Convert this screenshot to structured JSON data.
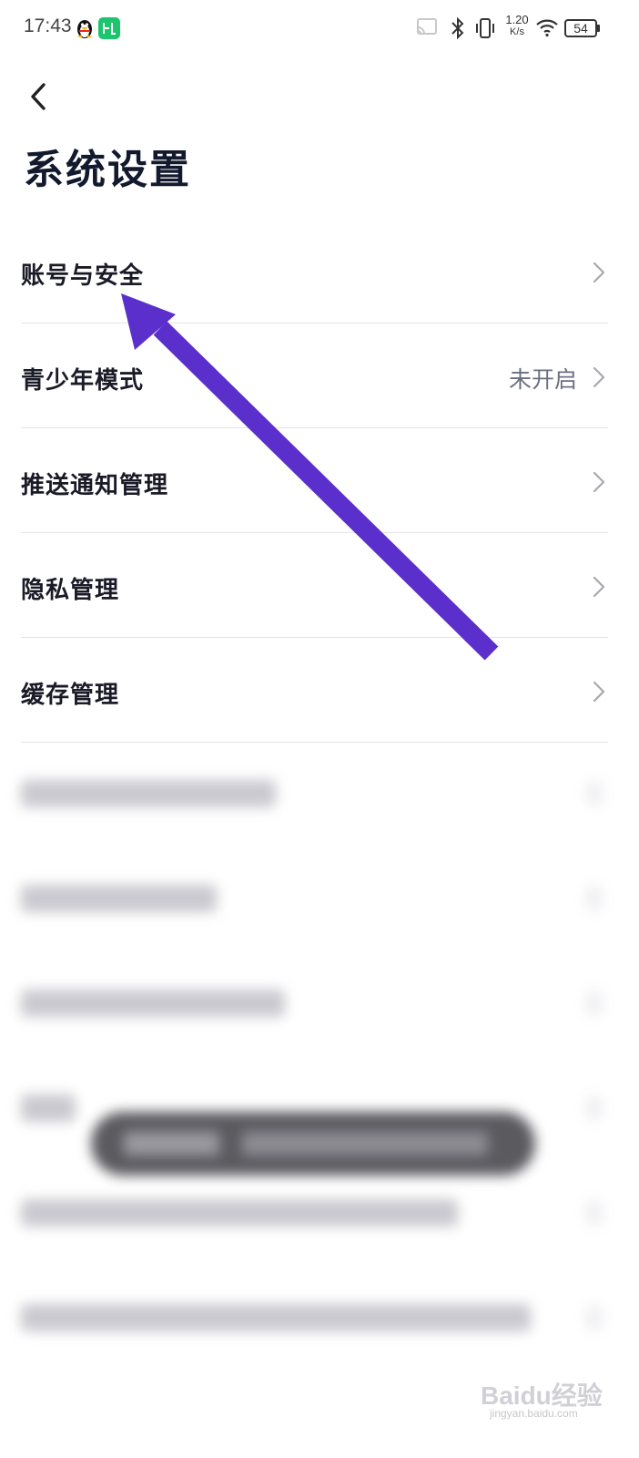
{
  "status_bar": {
    "time": "17:43",
    "speed_value": "1.20",
    "speed_unit": "K/s",
    "battery": "54"
  },
  "header": {
    "title": "系统设置"
  },
  "settings": [
    {
      "label": "账号与安全",
      "value": ""
    },
    {
      "label": "青少年模式",
      "value": "未开启"
    },
    {
      "label": "推送通知管理",
      "value": ""
    },
    {
      "label": "隐私管理",
      "value": ""
    },
    {
      "label": "缓存管理",
      "value": ""
    }
  ],
  "annotation": {
    "color": "#5a2fcb"
  },
  "watermark": {
    "text": "Baidu经验",
    "sub": "jingyan.baidu.com"
  }
}
